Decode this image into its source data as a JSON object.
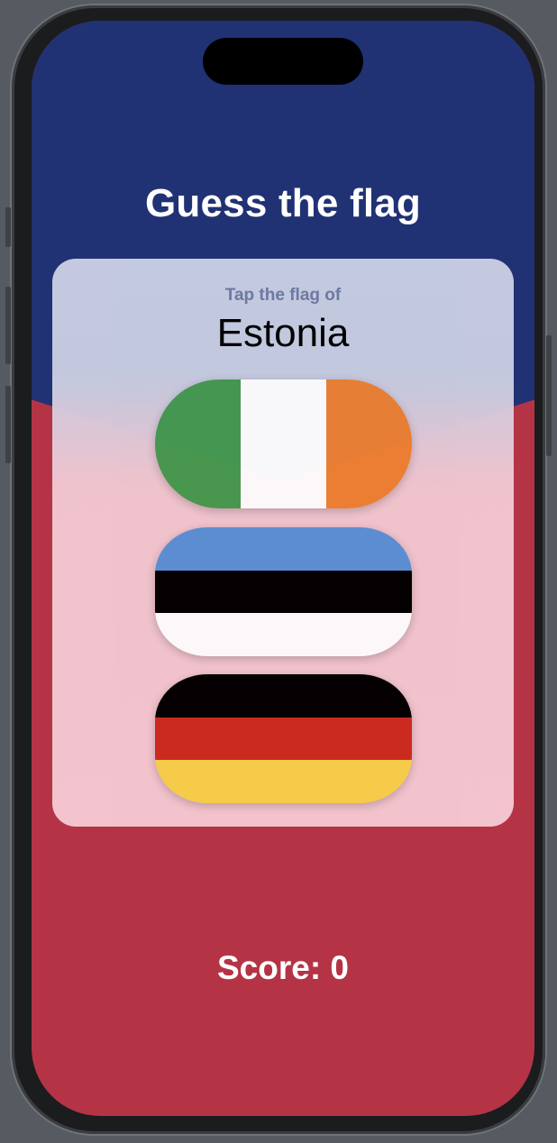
{
  "app": {
    "title": "Guess the flag",
    "prompt": "Tap the flag of",
    "country": "Estonia",
    "score_label": "Score: 0"
  },
  "colors": {
    "top_background": "#203274",
    "bottom_background": "#b43446",
    "prompt_text": "#6f7ca3"
  },
  "flags": [
    {
      "country": "Ireland",
      "orientation": "vertical",
      "stripes": [
        "#469a4f",
        "#ffffff",
        "#ee8133"
      ]
    },
    {
      "country": "Estonia",
      "orientation": "horizontal",
      "stripes": [
        "#5b90d6",
        "#000000",
        "#ffffff"
      ]
    },
    {
      "country": "Germany",
      "orientation": "horizontal",
      "stripes": [
        "#000000",
        "#cc2b1e",
        "#f8d04a"
      ]
    }
  ]
}
